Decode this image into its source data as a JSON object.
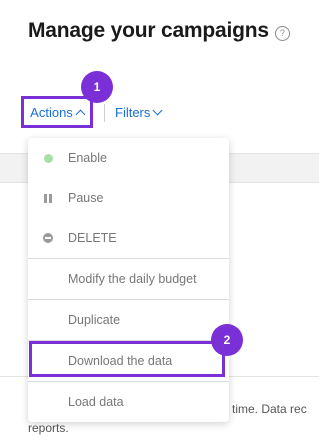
{
  "page": {
    "title": "Manage your campaigns",
    "help_icon": "help-circle-icon"
  },
  "toolbar": {
    "actions_label": "Actions",
    "filters_label": "Filters"
  },
  "menu": {
    "items": [
      {
        "label": "Enable",
        "icon": "enable-dot-icon",
        "status_color": "#a7e0a7"
      },
      {
        "label": "Pause",
        "icon": "pause-icon"
      },
      {
        "label": "DELETE",
        "icon": "delete-icon"
      },
      {
        "label": "Modify the daily budget"
      },
      {
        "label": "Duplicate"
      },
      {
        "label": "Download the data"
      },
      {
        "label": "Load data"
      }
    ]
  },
  "annotations": {
    "step1": "1",
    "step2": "2",
    "accent": "#7b2fd6"
  },
  "background_text": {
    "line1": "time. Data rec",
    "line2": "reports."
  }
}
